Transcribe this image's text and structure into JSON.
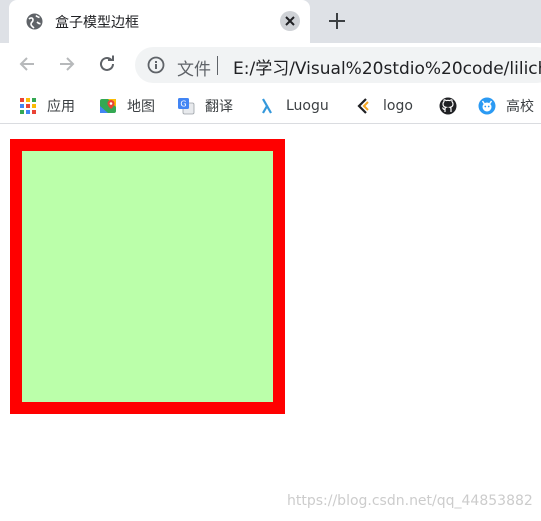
{
  "tab": {
    "title": "盒子模型边框",
    "close_label": "✕",
    "new_tab_label": "+"
  },
  "toolbar": {
    "site_label": "文件",
    "url": "E:/学习/Visual%20stdio%20code/lilich"
  },
  "bookmarks": [
    {
      "label": "应用",
      "icon": "apps-grid-icon"
    },
    {
      "label": "地图",
      "icon": "maps-icon"
    },
    {
      "label": "翻译",
      "icon": "translate-icon"
    },
    {
      "label": "Luogu",
      "icon": "luogu-icon"
    },
    {
      "label": "logo",
      "icon": "logo-icon"
    },
    {
      "label": "",
      "icon": "github-icon"
    },
    {
      "label": "高校",
      "icon": "school-icon"
    }
  ],
  "colors": {
    "box_fill": "#bbffaa",
    "box_border": "#ff0000"
  },
  "watermark": "https://blog.csdn.net/qq_44853882"
}
